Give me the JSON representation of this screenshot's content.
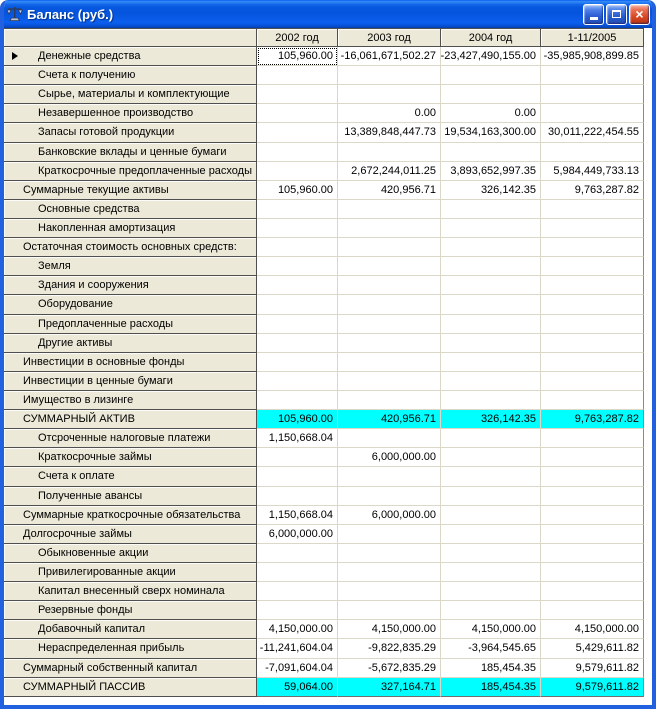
{
  "window": {
    "title": "Баланс (руб.)",
    "controls": {
      "minimize": "minimize",
      "maximize": "maximize",
      "close": "close"
    }
  },
  "colors": {
    "titlebar_blue": "#0554DE",
    "header_bg": "#ECE9D8",
    "highlight_cyan": "#00FFFF",
    "grid_line": "#DCD8C8"
  },
  "table": {
    "columns": [
      "2002 год",
      "2003 год",
      "2004 год",
      "1-11/2005"
    ],
    "rows": [
      {
        "label": "Денежные средства",
        "level": 1,
        "values": [
          "105,960.00",
          "-16,061,671,502.27",
          "-23,427,490,155.00",
          "-35,985,908,899.85"
        ]
      },
      {
        "label": "Счета к получению",
        "level": 1,
        "values": [
          "",
          "",
          "",
          ""
        ]
      },
      {
        "label": "Сырье, материалы и комплектующие",
        "level": 1,
        "values": [
          "",
          "",
          "",
          ""
        ]
      },
      {
        "label": "Незавершенное производство",
        "level": 1,
        "values": [
          "",
          "0.00",
          "0.00",
          ""
        ]
      },
      {
        "label": "Запасы готовой продукции",
        "level": 1,
        "values": [
          "",
          "13,389,848,447.73",
          "19,534,163,300.00",
          "30,011,222,454.55"
        ]
      },
      {
        "label": "Банковские вклады и ценные бумаги",
        "level": 1,
        "values": [
          "",
          "",
          "",
          ""
        ]
      },
      {
        "label": "Краткосрочные предоплаченные расходы",
        "level": 1,
        "values": [
          "",
          "2,672,244,011.25",
          "3,893,652,997.35",
          "5,984,449,733.13"
        ]
      },
      {
        "label": "Суммарные текущие активы",
        "level": 0,
        "values": [
          "105,960.00",
          "420,956.71",
          "326,142.35",
          "9,763,287.82"
        ]
      },
      {
        "label": "Основные средства",
        "level": 1,
        "values": [
          "",
          "",
          "",
          ""
        ]
      },
      {
        "label": "Накопленная амортизация",
        "level": 1,
        "values": [
          "",
          "",
          "",
          ""
        ]
      },
      {
        "label": "Остаточная стоимость основных средств:",
        "level": 0,
        "values": [
          "",
          "",
          "",
          ""
        ]
      },
      {
        "label": "Земля",
        "level": 1,
        "values": [
          "",
          "",
          "",
          ""
        ]
      },
      {
        "label": "Здания и сооружения",
        "level": 1,
        "values": [
          "",
          "",
          "",
          ""
        ]
      },
      {
        "label": "Оборудование",
        "level": 1,
        "values": [
          "",
          "",
          "",
          ""
        ]
      },
      {
        "label": "Предоплаченные расходы",
        "level": 1,
        "values": [
          "",
          "",
          "",
          ""
        ]
      },
      {
        "label": "Другие активы",
        "level": 1,
        "values": [
          "",
          "",
          "",
          ""
        ]
      },
      {
        "label": "Инвестиции в основные фонды",
        "level": 0,
        "values": [
          "",
          "",
          "",
          ""
        ]
      },
      {
        "label": "Инвестиции в ценные бумаги",
        "level": 0,
        "values": [
          "",
          "",
          "",
          ""
        ]
      },
      {
        "label": "Имущество в лизинге",
        "level": 0,
        "values": [
          "",
          "",
          "",
          ""
        ]
      },
      {
        "label": "СУММАРНЫЙ АКТИВ",
        "level": 0,
        "highlight": true,
        "values": [
          "105,960.00",
          "420,956.71",
          "326,142.35",
          "9,763,287.82"
        ]
      },
      {
        "label": "Отсроченные налоговые платежи",
        "level": 1,
        "values": [
          "1,150,668.04",
          "",
          "",
          ""
        ]
      },
      {
        "label": "Краткосрочные займы",
        "level": 1,
        "values": [
          "",
          "6,000,000.00",
          "",
          ""
        ]
      },
      {
        "label": "Счета к оплате",
        "level": 1,
        "values": [
          "",
          "",
          "",
          ""
        ]
      },
      {
        "label": "Полученные авансы",
        "level": 1,
        "values": [
          "",
          "",
          "",
          ""
        ]
      },
      {
        "label": "Суммарные краткосрочные обязательства",
        "level": 0,
        "values": [
          "1,150,668.04",
          "6,000,000.00",
          "",
          ""
        ]
      },
      {
        "label": "Долгосрочные займы",
        "level": 0,
        "values": [
          "6,000,000.00",
          "",
          "",
          ""
        ]
      },
      {
        "label": "Обыкновенные акции",
        "level": 1,
        "values": [
          "",
          "",
          "",
          ""
        ]
      },
      {
        "label": "Привилегированные акции",
        "level": 1,
        "values": [
          "",
          "",
          "",
          ""
        ]
      },
      {
        "label": "Капитал внесенный сверх номинала",
        "level": 1,
        "values": [
          "",
          "",
          "",
          ""
        ]
      },
      {
        "label": "Резервные фонды",
        "level": 1,
        "values": [
          "",
          "",
          "",
          ""
        ]
      },
      {
        "label": "Добавочный капитал",
        "level": 1,
        "values": [
          "4,150,000.00",
          "4,150,000.00",
          "4,150,000.00",
          "4,150,000.00"
        ]
      },
      {
        "label": "Нераспределенная прибыль",
        "level": 1,
        "values": [
          "-11,241,604.04",
          "-9,822,835.29",
          "-3,964,545.65",
          "5,429,611.82"
        ]
      },
      {
        "label": "Суммарный собственный капитал",
        "level": 0,
        "values": [
          "-7,091,604.04",
          "-5,672,835.29",
          "185,454.35",
          "9,579,611.82"
        ]
      },
      {
        "label": "СУММАРНЫЙ ПАССИВ",
        "level": 0,
        "highlight": true,
        "values": [
          "59,064.00",
          "327,164.71",
          "185,454.35",
          "9,579,611.82"
        ]
      }
    ],
    "selection": {
      "row": 0,
      "col": 0
    }
  }
}
